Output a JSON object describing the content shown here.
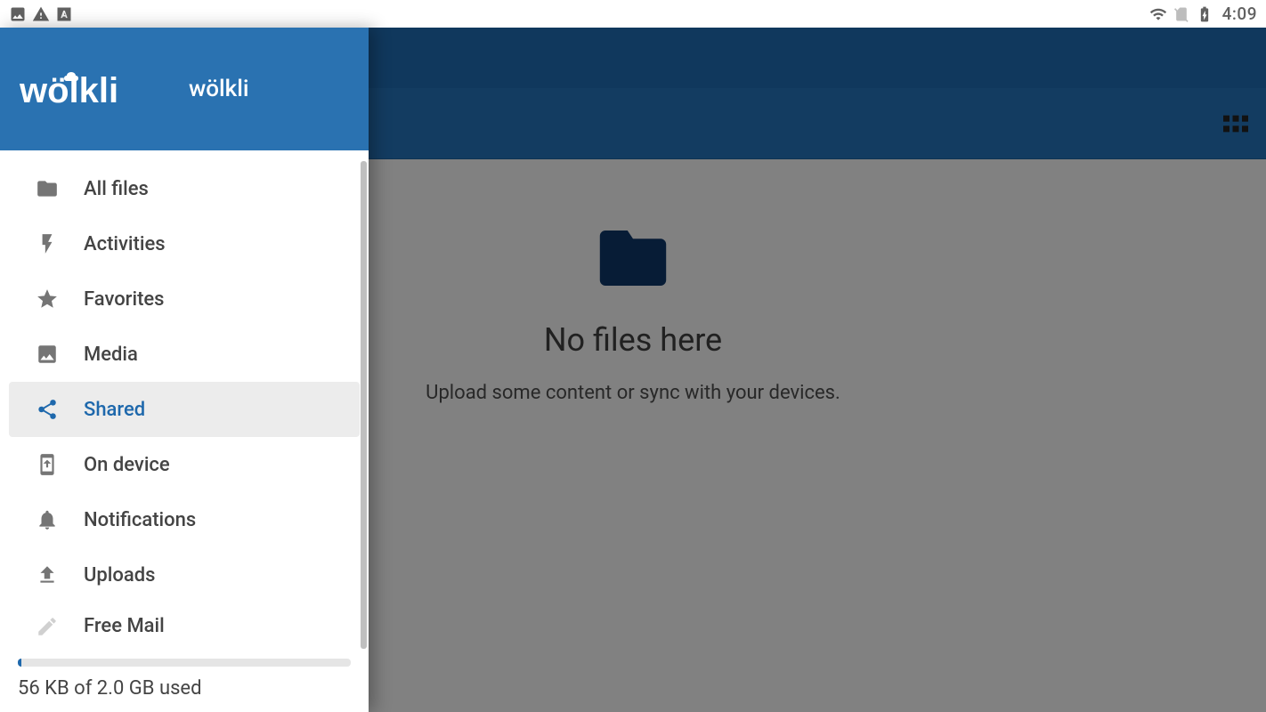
{
  "statusbar": {
    "time": "4:09"
  },
  "drawer": {
    "app_name": "wölkli",
    "items": [
      {
        "id": "all-files",
        "label": "All files",
        "icon": "folder-icon",
        "selected": false
      },
      {
        "id": "activities",
        "label": "Activities",
        "icon": "bolt-icon",
        "selected": false
      },
      {
        "id": "favorites",
        "label": "Favorites",
        "icon": "star-icon",
        "selected": false
      },
      {
        "id": "media",
        "label": "Media",
        "icon": "image-icon",
        "selected": false
      },
      {
        "id": "shared",
        "label": "Shared",
        "icon": "share-icon",
        "selected": true
      },
      {
        "id": "on-device",
        "label": "On device",
        "icon": "device-icon",
        "selected": false
      },
      {
        "id": "notifications",
        "label": "Notifications",
        "icon": "bell-icon",
        "selected": false
      },
      {
        "id": "uploads",
        "label": "Uploads",
        "icon": "upload-icon",
        "selected": false
      },
      {
        "id": "free-mail",
        "label": "Free Mail",
        "icon": "pen-icon",
        "selected": false
      }
    ],
    "quota_text": "56 KB of 2.0 GB used"
  },
  "main": {
    "empty_title": "No files here",
    "empty_subtitle": "Upload some content or sync with your devices."
  }
}
